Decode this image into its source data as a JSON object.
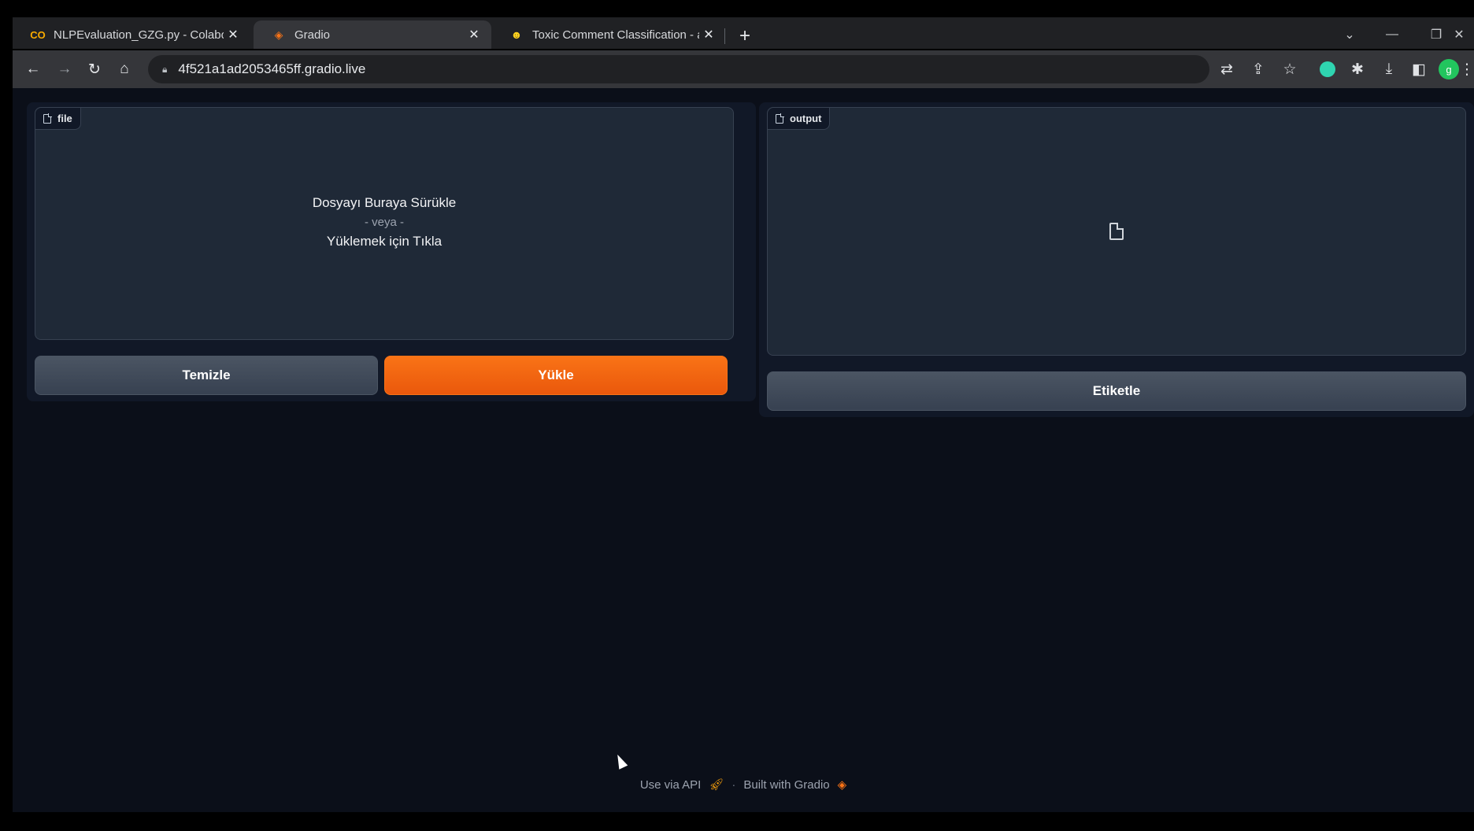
{
  "browser": {
    "tabs": [
      {
        "title": "NLPEvaluation_GZG.py - Colabor",
        "favicon": "colab-icon",
        "active": false
      },
      {
        "title": "Gradio",
        "favicon": "gradio-icon",
        "active": true
      },
      {
        "title": "Toxic Comment Classification - a",
        "favicon": "huggingface-icon",
        "active": false
      }
    ],
    "new_tab_label": "+",
    "url": "4f521a1ad2053465ff.gradio.live",
    "profile_initial": "g"
  },
  "left": {
    "file_label": "file",
    "drop_title": "Dosyayı Buraya Sürükle",
    "drop_or": "- veya -",
    "drop_click": "Yüklemek için Tıkla",
    "clear_button": "Temizle",
    "upload_button": "Yükle"
  },
  "right": {
    "output_label": "output",
    "label_button": "Etiketle"
  },
  "footer": {
    "api_text": "Use via API",
    "separator": "·",
    "built_text": "Built with Gradio"
  },
  "colors": {
    "primary": "#f97316",
    "background": "#0b0f19",
    "panel": "#1f2937"
  }
}
